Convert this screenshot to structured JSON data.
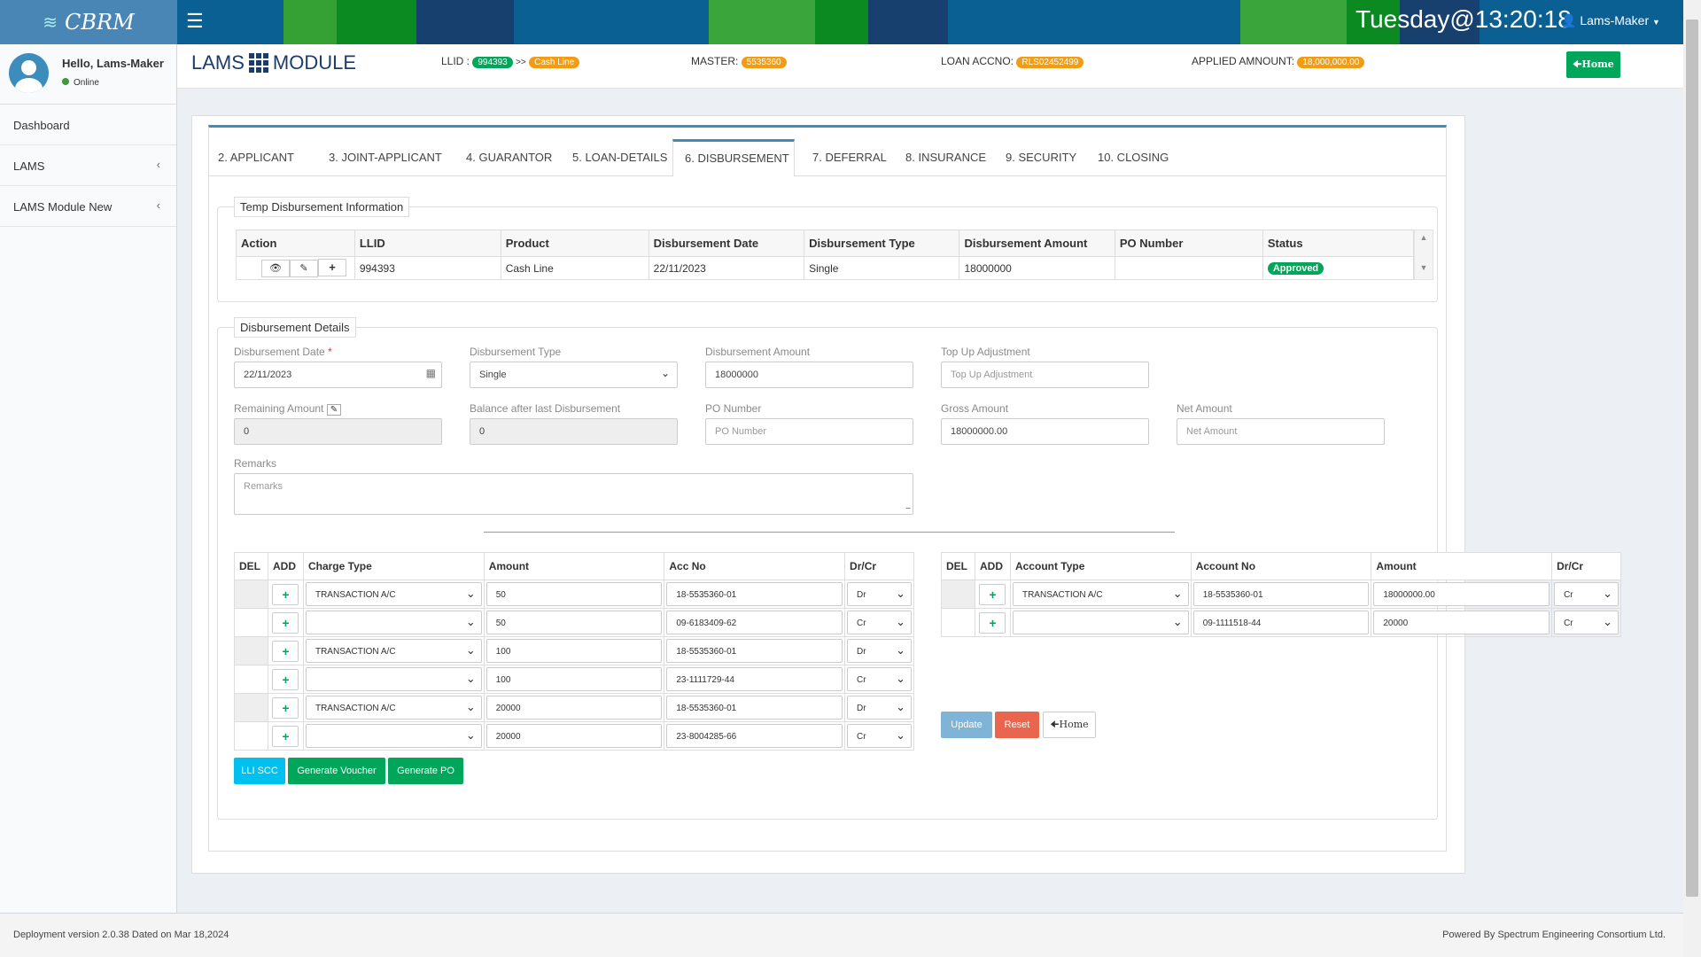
{
  "topbar": {
    "logo": "CBRM",
    "clock": "Tuesday@13:20:18",
    "user": "Lams-Maker"
  },
  "sidebar": {
    "greeting": "Hello, Lams-Maker",
    "status": "Online",
    "items": [
      {
        "label": "Dashboard"
      },
      {
        "label": "LAMS"
      },
      {
        "label": "LAMS Module New"
      }
    ]
  },
  "header": {
    "title_left": "LAMS",
    "title_right": "MODULE",
    "llid_label": "LLID :",
    "llid_value": "994393",
    "llid_sep": ">>",
    "llid_product": "Cash Line",
    "master_label": "MASTER:",
    "master_value": "5535360",
    "loan_label": "LOAN ACCNO:",
    "loan_value": "RLS02452499",
    "applied_label": "APPLIED AMNOUNT:",
    "applied_value": "18,000,000.00",
    "home_label": "Home"
  },
  "tabs": [
    {
      "label": "2. APPLICANT"
    },
    {
      "label": "3. JOINT-APPLICANT"
    },
    {
      "label": "4. GUARANTOR"
    },
    {
      "label": "5. LOAN-DETAILS"
    },
    {
      "label": "6. DISBURSEMENT"
    },
    {
      "label": "7. DEFERRAL"
    },
    {
      "label": "8. INSURANCE"
    },
    {
      "label": "9. SECURITY"
    },
    {
      "label": "10. CLOSING"
    }
  ],
  "temp": {
    "legend": "Temp Disbursement Information",
    "headers": [
      "Action",
      "LLID",
      "Product",
      "Disbursement Date",
      "Disbursement Type",
      "Disbursement Amount",
      "PO Number",
      "Status"
    ],
    "row": {
      "llid": "994393",
      "product": "Cash Line",
      "date": "22/11/2023",
      "type": "Single",
      "amount": "18000000",
      "po": "",
      "status": "Approved"
    }
  },
  "details": {
    "legend": "Disbursement Details",
    "date_label": "Disbursement Date",
    "date_required": "*",
    "date_value": "22/11/2023",
    "type_label": "Disbursement Type",
    "type_value": "Single",
    "amount_label": "Disbursement Amount",
    "amount_value": "18000000",
    "topup_label": "Top Up Adjustment",
    "topup_placeholder": "Top Up Adjustment",
    "remaining_label": "Remaining Amount",
    "remaining_value": "0",
    "balance_label": "Balance after last Disbursement",
    "balance_value": "0",
    "po_label": "PO Number",
    "po_placeholder": "PO Number",
    "gross_label": "Gross Amount",
    "gross_value": "18000000.00",
    "net_label": "Net Amount",
    "net_placeholder": "Net Amount",
    "remarks_label": "Remarks",
    "remarks_placeholder": "Remarks"
  },
  "charges": {
    "headers": [
      "DEL",
      "ADD",
      "Charge Type",
      "Amount",
      "Acc No",
      "Dr/Cr"
    ],
    "rows": [
      {
        "type": "TRANSACTION A/C",
        "amount": "50",
        "acc": "18-5535360-01",
        "drcr": "Dr"
      },
      {
        "type": "",
        "amount": "50",
        "acc": "09-6183409-62",
        "drcr": "Cr"
      },
      {
        "type": "TRANSACTION A/C",
        "amount": "100",
        "acc": "18-5535360-01",
        "drcr": "Dr"
      },
      {
        "type": "",
        "amount": "100",
        "acc": "23-1111729-44",
        "drcr": "Cr"
      },
      {
        "type": "TRANSACTION A/C",
        "amount": "20000",
        "acc": "18-5535360-01",
        "drcr": "Dr"
      },
      {
        "type": "",
        "amount": "20000",
        "acc": "23-8004285-66",
        "drcr": "Cr"
      }
    ]
  },
  "accounts": {
    "headers": [
      "DEL",
      "ADD",
      "Account Type",
      "Account No",
      "Amount",
      "Dr/Cr"
    ],
    "rows": [
      {
        "type": "TRANSACTION A/C",
        "acc": "18-5535360-01",
        "amount": "18000000.00",
        "drcr": "Cr"
      },
      {
        "type": "",
        "acc": "09-1111518-44",
        "amount": "20000",
        "drcr": "Cr"
      }
    ]
  },
  "buttons": {
    "lli_scc": "LLI SCC",
    "gen_voucher": "Generate Voucher",
    "gen_po": "Generate PO",
    "update": "Update",
    "reset": "Reset",
    "home": "Home"
  },
  "footer": {
    "left": "Deployment version 2.0.38 Dated on Mar 18,2024",
    "right": "Powered By Spectrum Engineering Consortium Ltd."
  },
  "colors": {
    "primary": "#3c8dbc",
    "success": "#00a65a",
    "warning": "#f39c12",
    "danger": "#dd4b39",
    "info": "#00c0ef"
  }
}
